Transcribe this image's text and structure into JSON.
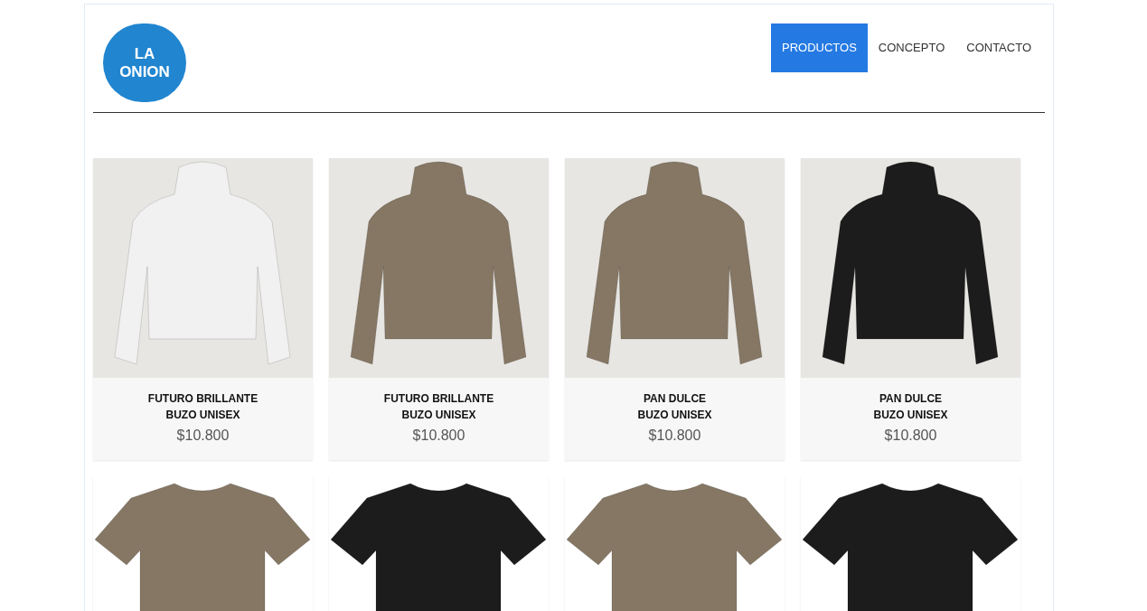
{
  "logo": {
    "line1": "LA",
    "line2": "ONION"
  },
  "nav": [
    {
      "label": "PRODUCTOS",
      "selected": true
    },
    {
      "label": "CONCEPTO",
      "selected": false
    },
    {
      "label": "CONTACTO",
      "selected": false
    }
  ],
  "products": [
    {
      "kind": "hoodie",
      "color": "#f1f1f1",
      "title": "FUTURO BRILLANTE",
      "subtitle": "BUZO UNISEX",
      "price": "$10.800"
    },
    {
      "kind": "hoodie",
      "color": "#857764",
      "title": "FUTURO BRILLANTE",
      "subtitle": "BUZO UNISEX",
      "price": "$10.800"
    },
    {
      "kind": "hoodie",
      "color": "#857764",
      "title": "PAN DULCE",
      "subtitle": "BUZO UNISEX",
      "price": "$10.800"
    },
    {
      "kind": "hoodie",
      "color": "#1c1c1c",
      "title": "PAN DULCE",
      "subtitle": "BUZO UNISEX",
      "price": "$10.800"
    },
    {
      "kind": "tshirt",
      "color": "#857764"
    },
    {
      "kind": "tshirt",
      "color": "#1c1c1c"
    },
    {
      "kind": "tshirt",
      "color": "#857764"
    },
    {
      "kind": "tshirt",
      "color": "#1c1c1c"
    }
  ]
}
